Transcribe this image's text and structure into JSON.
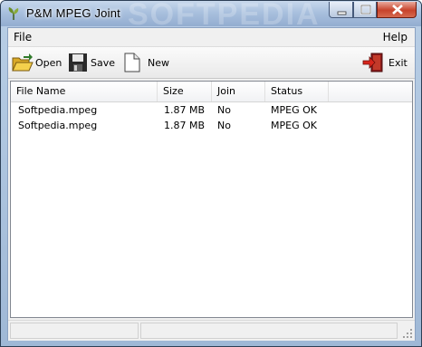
{
  "window": {
    "title": "P&M MPEG Joint",
    "watermark": "SOFTPEDIA"
  },
  "menu": {
    "file": "File",
    "help": "Help"
  },
  "toolbar": {
    "open": "Open",
    "save": "Save",
    "new": "New",
    "exit": "Exit"
  },
  "list": {
    "columns": [
      "File Name",
      "Size",
      "Join",
      "Status"
    ],
    "rows": [
      {
        "file_name": "Softpedia.mpeg",
        "size": "1.87 MB",
        "join": "No",
        "status": "MPEG OK"
      },
      {
        "file_name": "Softpedia.mpeg",
        "size": "1.87 MB",
        "join": "No",
        "status": "MPEG OK"
      }
    ]
  },
  "icons": {
    "app": "leaf-icon",
    "open": "folder-open-icon",
    "save": "floppy-disk-icon",
    "new": "new-document-icon",
    "exit": "exit-door-icon"
  }
}
